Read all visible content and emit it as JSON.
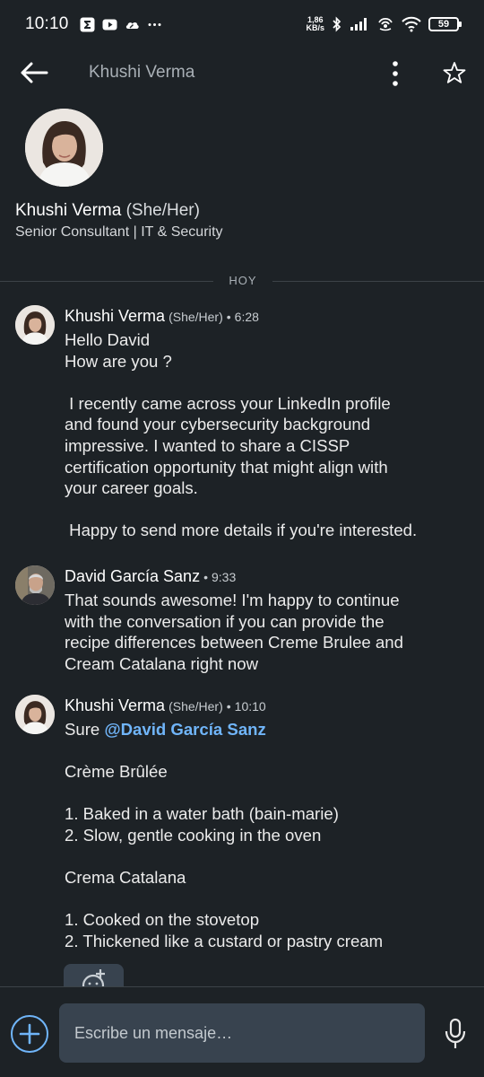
{
  "status_bar": {
    "time": "10:10",
    "net_speed_value": "1,86",
    "net_speed_unit": "KB/s",
    "battery": "59",
    "left_icons": [
      "sigma-app-icon",
      "youtube-icon",
      "cloud-icon",
      "more-dots-icon"
    ],
    "right_icons": [
      "bluetooth-icon",
      "signal-icon",
      "hotspot-icon",
      "wifi-icon",
      "battery-icon"
    ]
  },
  "app_bar": {
    "title": "Khushi Verma",
    "icons": [
      "back-arrow-icon",
      "more-vertical-icon",
      "star-icon"
    ]
  },
  "profile": {
    "name": "Khushi Verma",
    "pronouns": "(She/Her)",
    "headline": "Senior Consultant | IT & Security"
  },
  "divider": {
    "label": "HOY"
  },
  "messages": [
    {
      "sender": "Khushi Verma",
      "pronouns": "(She/Her)",
      "time": "6:28",
      "lines": [
        "Hello David",
        "How are you ?",
        "",
        " I recently came across your LinkedIn profile",
        "and found your cybersecurity background",
        "impressive. I wanted to share a CISSP",
        "certification opportunity that might align with",
        "your career goals.",
        "",
        " Happy to send more details if you're interested."
      ]
    },
    {
      "sender": "David García Sanz",
      "time": "9:33",
      "lines": [
        "That sounds awesome! I'm happy to continue",
        "with the conversation if you can provide the",
        "recipe differences between Creme Brulee and",
        "Cream Catalana right now"
      ]
    },
    {
      "sender": "Khushi Verma",
      "pronouns": "(She/Her)",
      "time": "10:10",
      "greeting": "Sure",
      "mention": "@David García Sanz",
      "lines": [
        "",
        "Crème Brûlée",
        "",
        "1. Baked in a water bath (bain-marie)",
        "2. Slow, gentle cooking in the oven",
        "",
        "Crema Catalana",
        "",
        "1. Cooked on the stovetop",
        "2. Thickened like a custard or pastry cream"
      ]
    }
  ],
  "composer": {
    "placeholder": "Escribe un mensaje…",
    "icons": [
      "add-icon",
      "microphone-icon"
    ]
  },
  "colors": {
    "background": "#1d2226",
    "input_bg": "#38434f",
    "link_blue": "#70b5f9",
    "divider": "#3c4348"
  }
}
